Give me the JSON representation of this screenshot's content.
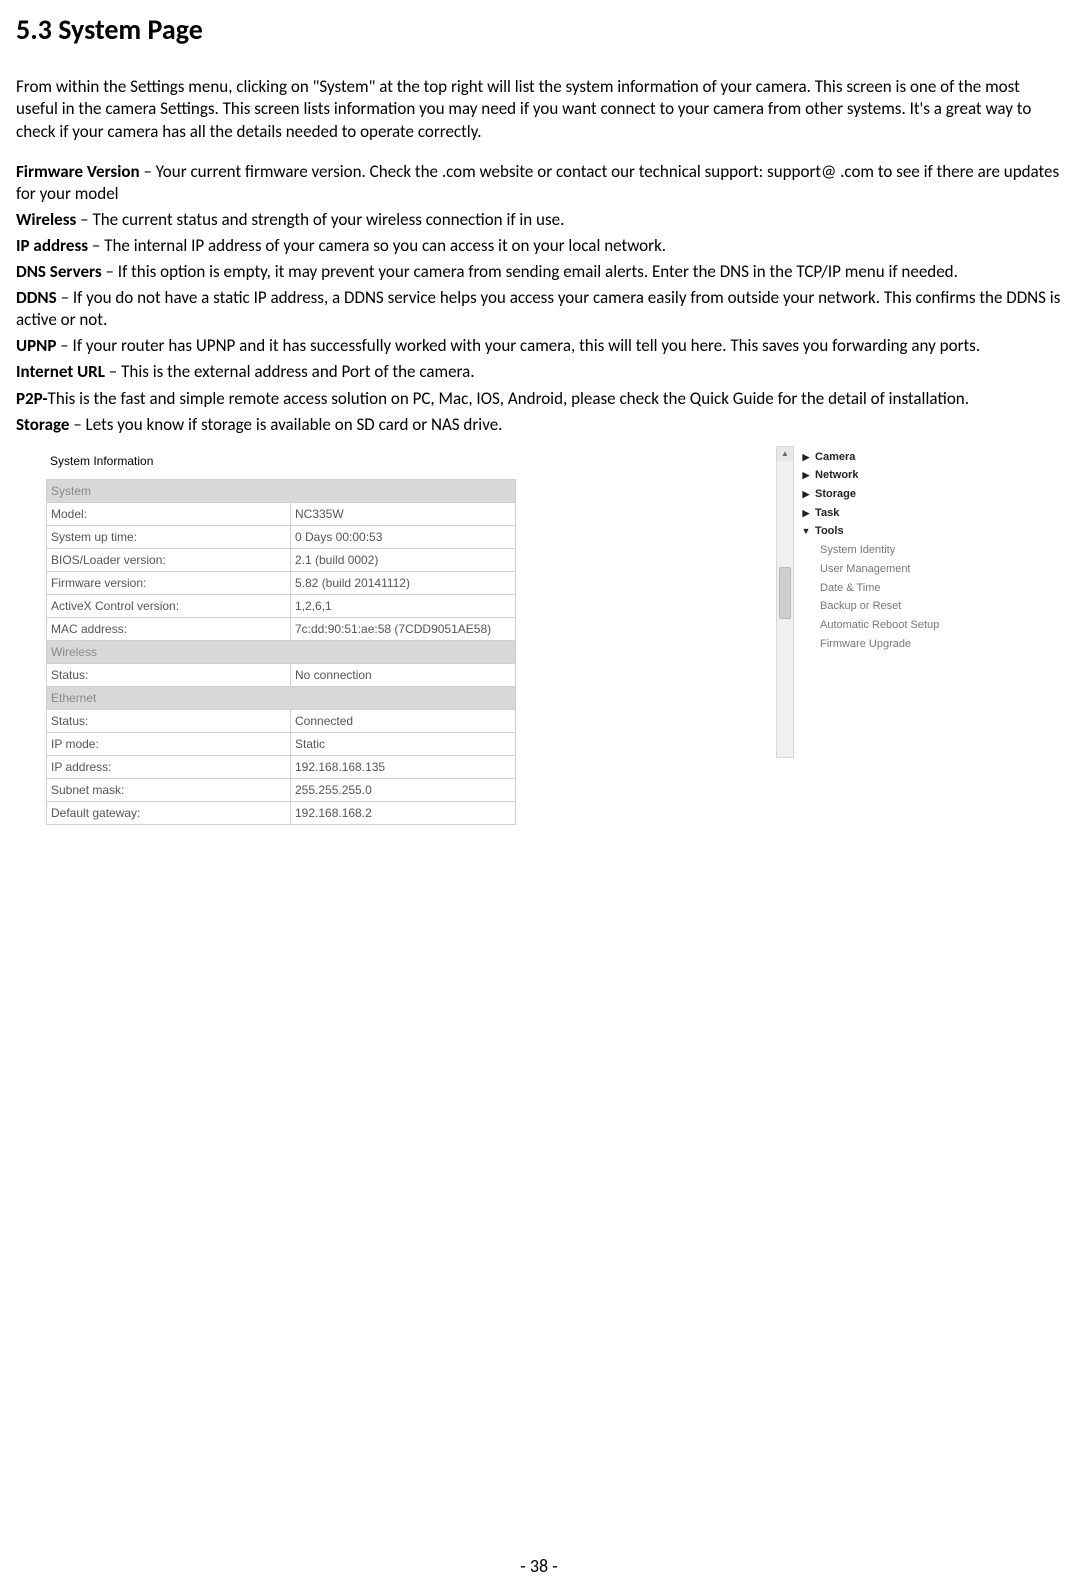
{
  "heading": "5.3 System Page",
  "intro": "From within the Settings menu, clicking on \"System\" at the top right will list the system information of your camera. This screen is one of the most useful in the camera Settings. This screen lists information you may need if you want connect to your camera from other systems. It's a great way to check if your camera has all the details needed to operate correctly.",
  "definitions": [
    {
      "term": "Firmware Version",
      "sep": " – ",
      "desc": "Your current firmware version. Check the     .com website or contact our technical support: support@ .com to see if there are updates for your model"
    },
    {
      "term": "Wireless",
      "sep": " – ",
      "desc": "The current status and strength of your wireless connection if in use."
    },
    {
      "term": "IP address",
      "sep": " – ",
      "desc": "The internal IP address of your camera so you can access it on your local network."
    },
    {
      "term": "DNS Servers",
      "sep": " – ",
      "desc": "If this option is empty, it may prevent your camera from sending email alerts. Enter the DNS in the TCP/IP menu if needed."
    },
    {
      "term": "DDNS",
      "sep": " – ",
      "desc": "If you do not have a static IP address, a DDNS service helps you access your camera easily from outside your network. This confirms the DDNS is active or not."
    },
    {
      "term": "UPNP",
      "sep": " – ",
      "desc": "If your router has UPNP and it has successfully worked with your camera, this will tell you here. This saves you forwarding any ports."
    },
    {
      "term": "Internet URL",
      "sep": " – ",
      "desc": "This is the external address and Port of the camera."
    },
    {
      "term": "P2P-",
      "sep": "",
      "desc": "This is the fast and simple remote access solution on PC, Mac, IOS, Android, please check the Quick Guide for the detail of installation."
    },
    {
      "term": "Storage",
      "sep": " – ",
      "desc": "Lets you know if storage is available on SD card or NAS drive."
    }
  ],
  "sysinfo": {
    "title": "System Information",
    "sections": [
      {
        "header": "System",
        "rows": [
          {
            "label": "Model:",
            "value": "NC335W"
          },
          {
            "label": "System up time:",
            "value": "0 Days 00:00:53"
          },
          {
            "label": "BIOS/Loader version:",
            "value": "2.1 (build 0002)"
          },
          {
            "label": "Firmware version:",
            "value": "5.82 (build 20141112)"
          },
          {
            "label": "ActiveX Control version:",
            "value": "1,2,6,1"
          },
          {
            "label": "MAC address:",
            "value": "7c:dd:90:51:ae:58 (7CDD9051AE58)"
          }
        ]
      },
      {
        "header": "Wireless",
        "rows": [
          {
            "label": "Status:",
            "value": "No connection"
          }
        ]
      },
      {
        "header": "Ethernet",
        "rows": [
          {
            "label": "Status:",
            "value": "Connected"
          },
          {
            "label": "IP mode:",
            "value": "Static"
          },
          {
            "label": "IP address:",
            "value": "192.168.168.135"
          },
          {
            "label": "Subnet mask:",
            "value": "255.255.255.0"
          },
          {
            "label": "Default gateway:",
            "value": "192.168.168.2"
          }
        ]
      }
    ]
  },
  "nav": {
    "top": [
      {
        "label": "Camera",
        "caret": "▶"
      },
      {
        "label": "Network",
        "caret": "▶"
      },
      {
        "label": "Storage",
        "caret": "▶"
      },
      {
        "label": "Task",
        "caret": "▶"
      },
      {
        "label": "Tools",
        "caret": "▼"
      }
    ],
    "sub": [
      "System Identity",
      "User Management",
      "Date & Time",
      "Backup or Reset",
      "Automatic Reboot Setup",
      "Firmware Upgrade"
    ]
  },
  "page_number": "- 38 -"
}
